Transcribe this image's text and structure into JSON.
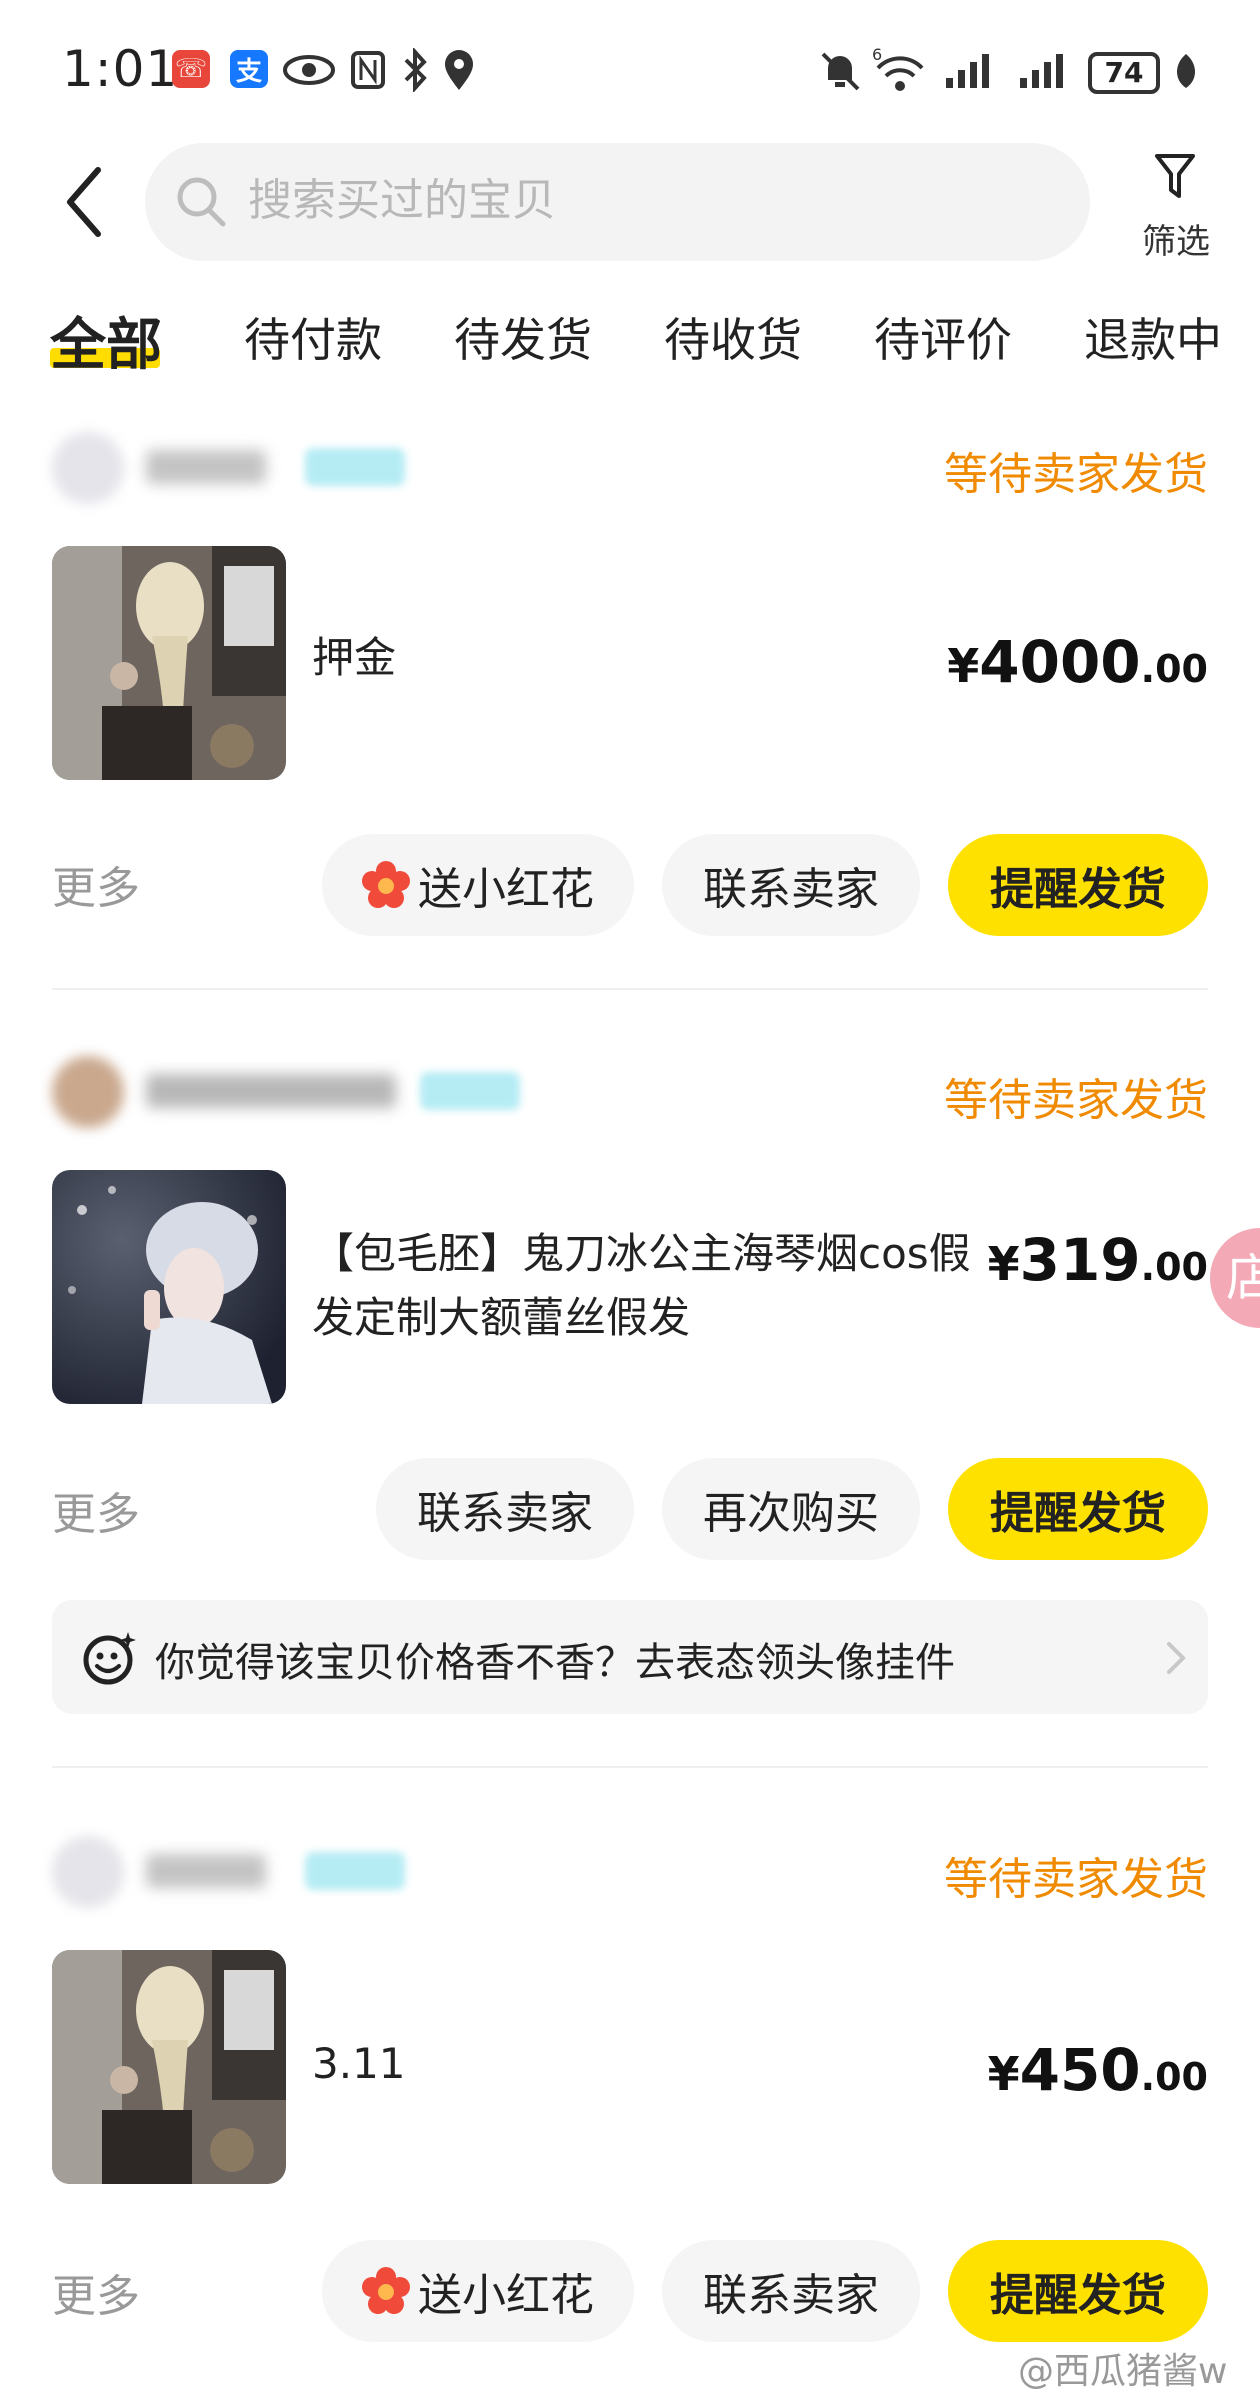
{
  "status_bar": {
    "time": "1:01",
    "battery": "74",
    "left_icons": [
      "phone-app-icon",
      "alipay-icon",
      "eye-icon",
      "nfc-icon",
      "bluetooth-icon",
      "location-icon"
    ],
    "right_icons": [
      "mute-bell-icon",
      "wifi-icon",
      "signal-icon",
      "signal-icon",
      "battery-icon",
      "leaf-icon"
    ],
    "app_icon_colors": {
      "red": "#e8463a",
      "blue": "#1677ff"
    }
  },
  "header": {
    "search_placeholder": "搜索买过的宝贝",
    "filter_label": "筛选"
  },
  "tabs": [
    {
      "label": "全部",
      "active": true
    },
    {
      "label": "待付款",
      "active": false
    },
    {
      "label": "待发货",
      "active": false
    },
    {
      "label": "待收货",
      "active": false
    },
    {
      "label": "待评价",
      "active": false
    },
    {
      "label": "退款中",
      "active": false
    }
  ],
  "orders": [
    {
      "status": "等待卖家发货",
      "item_title": "押金",
      "price": {
        "symbol": "¥",
        "integer": "4000",
        "decimal": ".00"
      },
      "more": "更多",
      "buttons": [
        {
          "label": "送小红花",
          "icon": "red-flower-icon",
          "primary": false
        },
        {
          "label": "联系卖家",
          "primary": false
        },
        {
          "label": "提醒发货",
          "primary": true
        }
      ]
    },
    {
      "status": "等待卖家发货",
      "item_title": "【包毛胚】鬼刀冰公主海琴烟cos假发定制大额蕾丝假发",
      "price": {
        "symbol": "¥",
        "integer": "319",
        "decimal": ".00"
      },
      "more": "更多",
      "buttons": [
        {
          "label": "联系卖家",
          "primary": false
        },
        {
          "label": "再次购买",
          "primary": false
        },
        {
          "label": "提醒发货",
          "primary": true
        }
      ],
      "promo": "你觉得该宝贝价格香不香？去表态领头像挂件"
    },
    {
      "status": "等待卖家发货",
      "item_title": "3.11",
      "price": {
        "symbol": "¥",
        "integer": "450",
        "decimal": ".00"
      },
      "more": "更多",
      "buttons": [
        {
          "label": "送小红花",
          "icon": "red-flower-icon",
          "primary": false
        },
        {
          "label": "联系卖家",
          "primary": false
        },
        {
          "label": "提醒发货",
          "primary": true
        }
      ]
    }
  ],
  "floating_shop_button": "店",
  "watermark": "@西瓜猪酱w",
  "colors": {
    "accent_yellow": "#ffe100",
    "status_orange": "#f08a00",
    "muted_gray": "#999999"
  }
}
